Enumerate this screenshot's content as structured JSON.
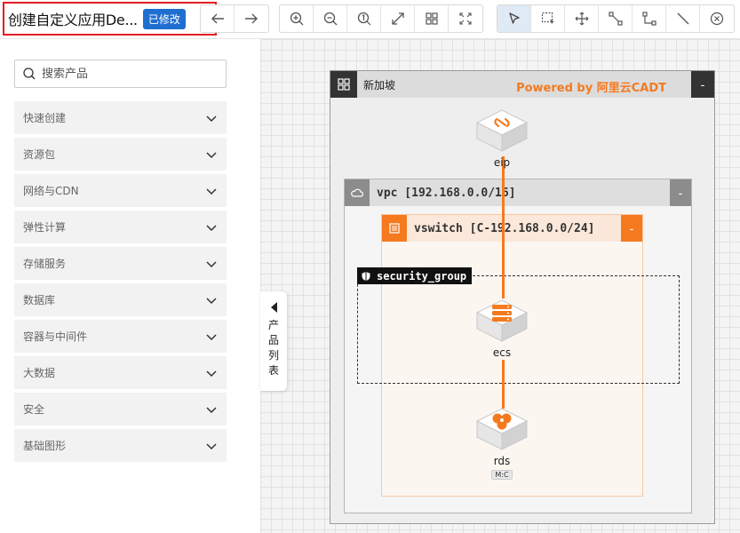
{
  "app": {
    "title": "创建自定义应用De...",
    "modified_badge": "已修改"
  },
  "toolbar": {
    "history": [
      "undo-icon",
      "redo-icon"
    ],
    "view": [
      "zoom-in-icon",
      "zoom-out-icon",
      "actual-size-icon",
      "fit-screen-icon",
      "grid-icon",
      "fullscreen-icon"
    ],
    "tools": [
      "pointer-icon",
      "marquee-select-icon",
      "move-icon",
      "connector-icon",
      "elbow-connector-icon",
      "line-icon",
      "close-circle-icon"
    ],
    "active_tool": "pointer-icon"
  },
  "sidebar": {
    "search_placeholder": "搜索产品",
    "categories": [
      {
        "label": "快速创建"
      },
      {
        "label": "资源包"
      },
      {
        "label": "网络与CDN"
      },
      {
        "label": "弹性计算"
      },
      {
        "label": "存储服务"
      },
      {
        "label": "数据库"
      },
      {
        "label": "容器与中间件"
      },
      {
        "label": "大数据"
      },
      {
        "label": "安全"
      },
      {
        "label": "基础图形"
      }
    ],
    "collapse_tab": "产品列表"
  },
  "diagram": {
    "region": {
      "name": "新加坡",
      "powered_by": "Powered by 阿里云CADT",
      "collapse": "-"
    },
    "vpc": {
      "name": "vpc [192.168.0.0/16]",
      "collapse": "-"
    },
    "vswitch": {
      "name": "vswitch [C-192.168.0.0/24]",
      "collapse": "-"
    },
    "security_group": {
      "name": "security_group"
    },
    "nodes": {
      "eip": {
        "label": "eip"
      },
      "ecs": {
        "label": "ecs"
      },
      "rds": {
        "label": "rds",
        "tag": "M:C"
      }
    }
  },
  "colors": {
    "accent": "#f57a1f",
    "badge": "#1f6fd1",
    "highlight_border": "#e51c23"
  }
}
